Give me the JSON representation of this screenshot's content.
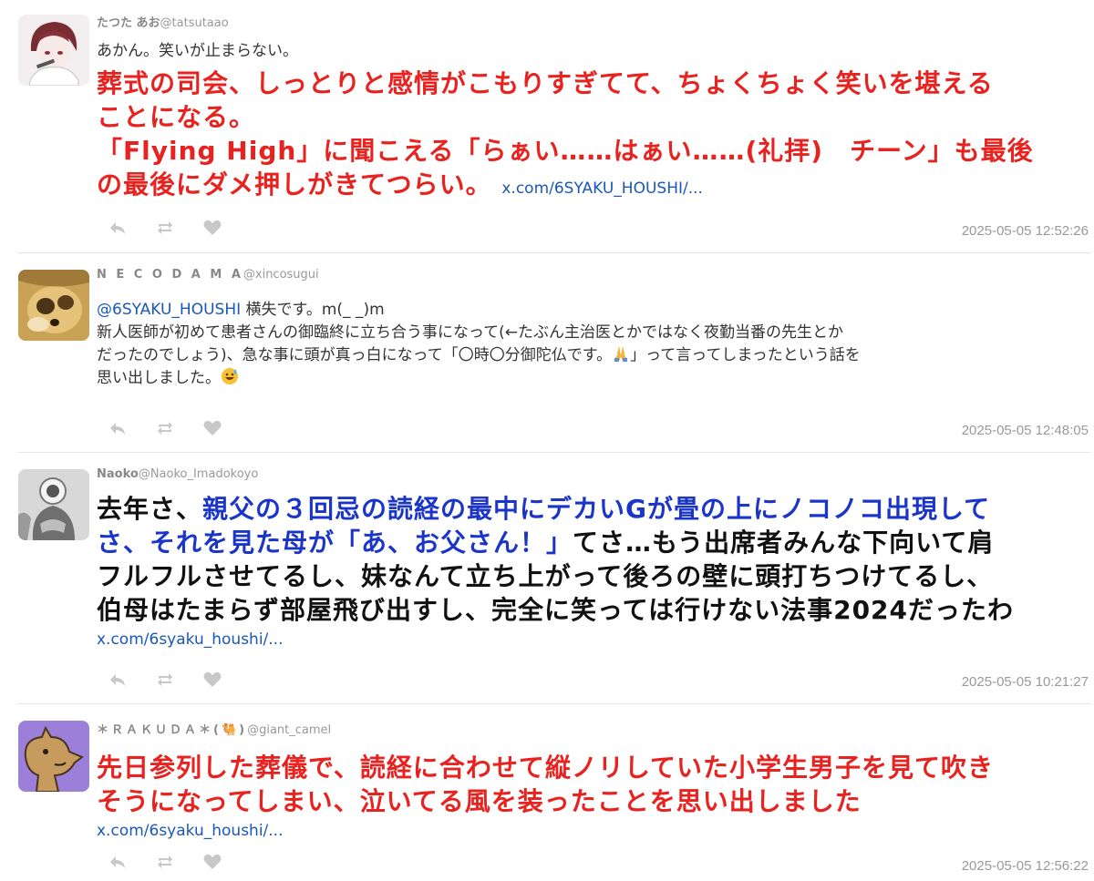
{
  "tweets": [
    {
      "name": "たつた あお",
      "handle": "@tatsutaao",
      "intro": "あかん。笑いが止まらない。",
      "lines": [
        "葬式の司会、しっとりと感情がこもりすぎてて、ちょくちょく笑いを堪える",
        "ことになる。",
        "「Flying High」に聞こえる「らぁい……はぁい……(礼拝)　チーン」も最後",
        "の最後にダメ押しがきてつらい。"
      ],
      "link": "x.com/6SYAKU_HOUSHI/...",
      "time": "2025-05-05 12:52:26"
    },
    {
      "name": "N E C O D A M A",
      "handle": "@xincosugui",
      "mention": "@6SYAKU_HOUSHI",
      "line1_rest": " 横失です。m(_ _)m",
      "line2": "新人医師が初めて患者さんの御臨終に立ち合う事になって(←たぶん主治医とかではなく夜勤当番の先生とか",
      "line3_a": "だったのでしょう)、急な事に頭が真っ白になって「〇時〇分御陀仏です。",
      "line3_b": "」って言ってしまったという話を",
      "line4": "思い出しました。",
      "time": "2025-05-05 12:48:05"
    },
    {
      "name": "Naoko",
      "handle": "@Naoko_Imadokoyo",
      "l1_black": "去年さ、",
      "l1_blue": "親父の３回忌の読経の最中にデカいGが畳の上にノコノコ出現して",
      "l2_blue": "さ、それを見た母が「あ、お父さん！」",
      "l2_black": "てさ…もう出席者みんな下向いて肩",
      "l3": "フルフルさせてるし、妹なんて立ち上がって後ろの壁に頭打ちつけてるし、",
      "l4": "伯母はたまらず部屋飛び出すし、完全に笑っては行けない法事2024だったわ",
      "link": "x.com/6syaku_houshi/...",
      "time": "2025-05-05 10:21:27"
    },
    {
      "name": "＊ＲＡＫＵＤＡ＊(🐫)",
      "handle": "@giant_camel",
      "lines": [
        "先日参列した葬儀で、読経に合わせて縦ノリしていた小学生男子を見て吹き",
        "そうになってしまい、泣いてる風を装ったことを思い出しました"
      ],
      "link": "x.com/6syaku_houshi/...",
      "time": "2025-05-05 12:56:22"
    }
  ],
  "colors": {
    "red": "#e8231f",
    "blue": "#1b35c8",
    "link": "#1b57b8",
    "meta": "#999999"
  },
  "icons": [
    "reply-icon",
    "retweet-icon",
    "like-icon",
    "praying-hands-emoji",
    "sweat-smile-emoji"
  ]
}
